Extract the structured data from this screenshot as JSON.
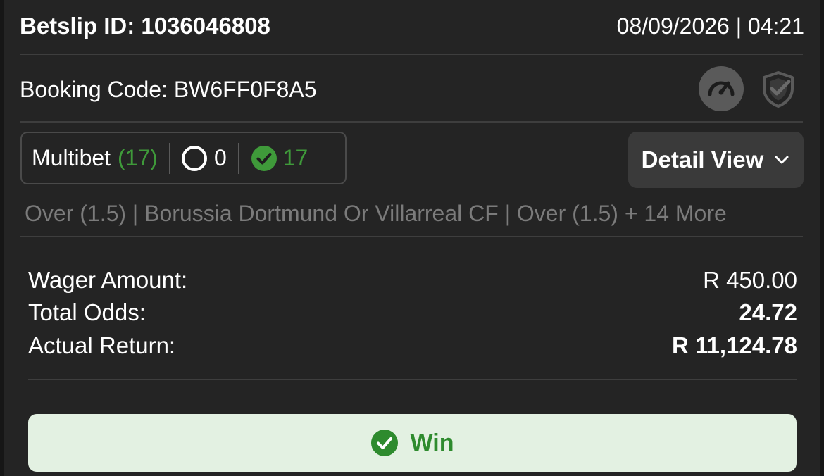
{
  "header": {
    "betslip_id": "Betslip ID: 1036046808",
    "datetime": "08/09/2026 | 04:21"
  },
  "booking": {
    "code_text": "Booking Code: BW6FF0F8A5",
    "icons": [
      "gauge-icon",
      "shield-check-icon"
    ]
  },
  "bet_status": {
    "type_label": "Multibet",
    "legs_count": "(17)",
    "open_count": "0",
    "won_count": "17"
  },
  "detail_view": {
    "label": "Detail View",
    "icon": "chevron-down-icon"
  },
  "selections_summary": "Over (1.5) | Borussia Dortmund Or Villarreal CF | Over (1.5) + 14 More",
  "summary": {
    "wager_label": "Wager Amount:",
    "wager_value": "R 450.00",
    "odds_label": "Total Odds:",
    "odds_value": "24.72",
    "return_label": "Actual Return:",
    "return_value": "R 11,124.78"
  },
  "result": {
    "label": "Win",
    "icon": "check-circle-icon"
  },
  "colors": {
    "accent_green": "#3f9a3a",
    "win_bg": "#e3f1e2",
    "card_bg": "#242424"
  }
}
